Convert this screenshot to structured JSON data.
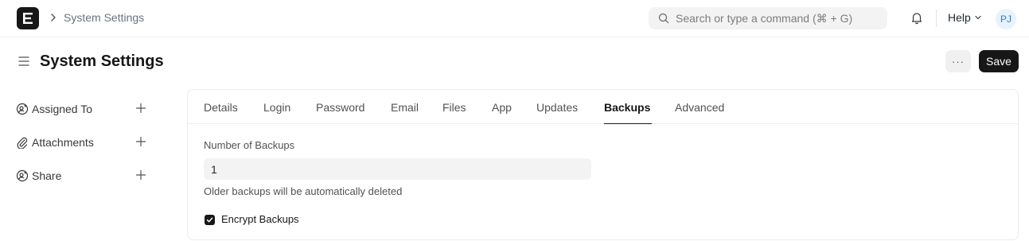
{
  "navbar": {
    "breadcrumb": "System Settings",
    "search_placeholder": "Search or type a command (⌘ + G)",
    "help_label": "Help",
    "avatar_initials": "PJ"
  },
  "page": {
    "title": "System Settings",
    "more_label": "···",
    "save_label": "Save"
  },
  "sidebar": {
    "items": [
      {
        "label": "Assigned To",
        "icon": "assign-user-icon"
      },
      {
        "label": "Attachments",
        "icon": "paperclip-icon"
      },
      {
        "label": "Share",
        "icon": "share-user-icon"
      }
    ]
  },
  "tabs": [
    {
      "label": "Details"
    },
    {
      "label": "Login"
    },
    {
      "label": "Password"
    },
    {
      "label": "Email"
    },
    {
      "label": "Files"
    },
    {
      "label": "App"
    },
    {
      "label": "Updates"
    },
    {
      "label": "Backups",
      "active": true
    },
    {
      "label": "Advanced"
    }
  ],
  "form": {
    "backups_label": "Number of Backups",
    "backups_value": "1",
    "backups_help": "Older backups will be automatically deleted",
    "encrypt_label": "Encrypt Backups",
    "encrypt_checked": true
  },
  "colors": {
    "primary": "#171717",
    "avatar_bg": "#e8f2fd",
    "avatar_text": "#2f7ad8"
  }
}
